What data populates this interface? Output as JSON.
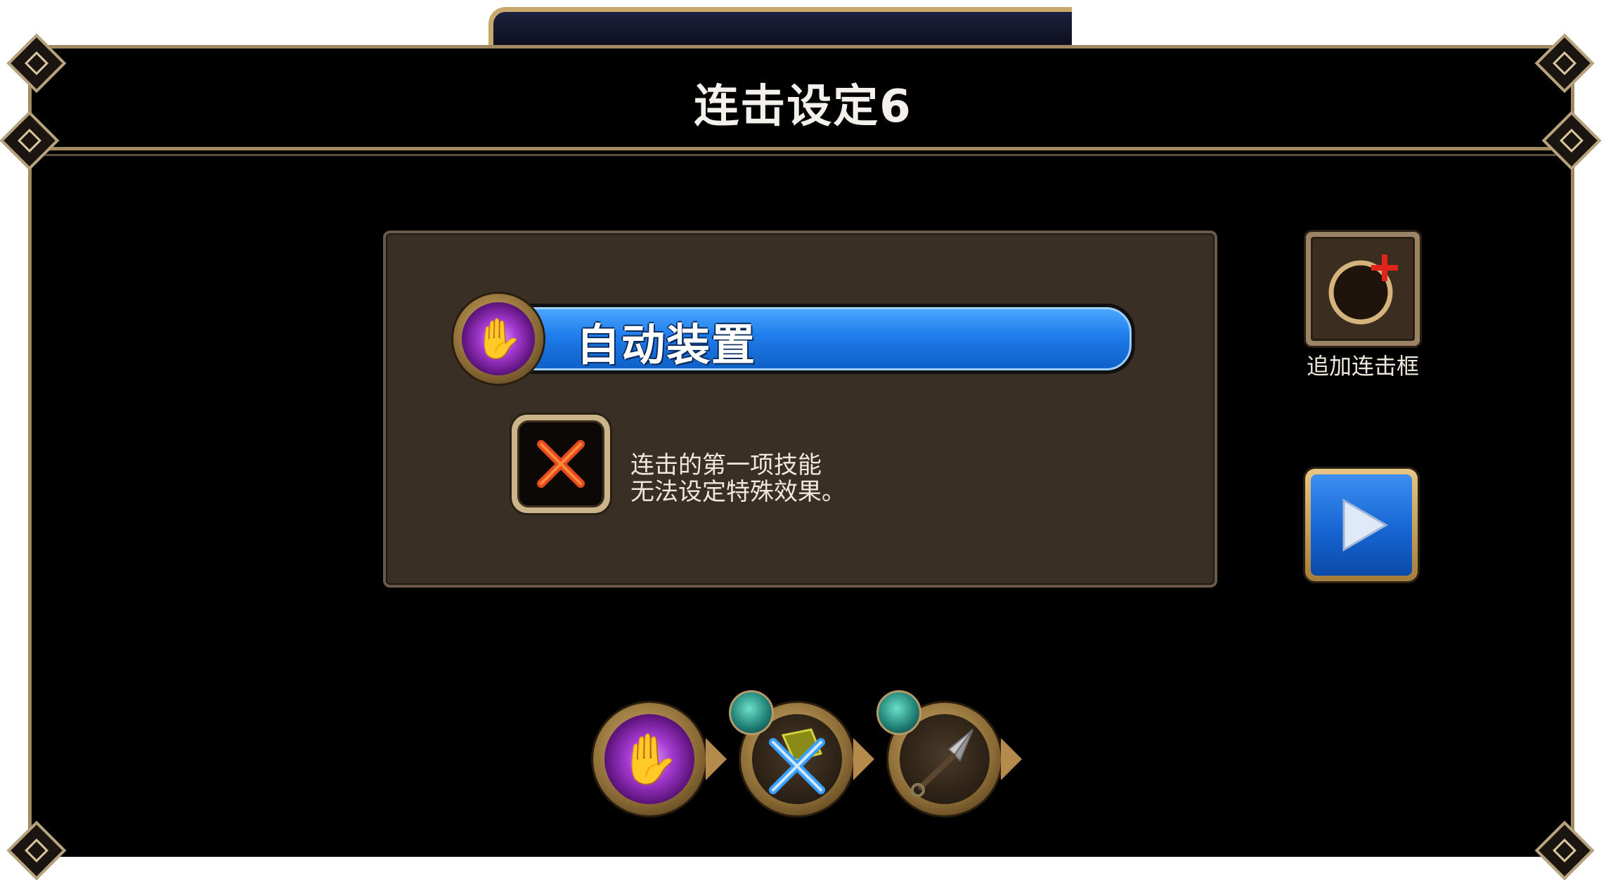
{
  "dialog": {
    "title": "连击设定6"
  },
  "auto_equip": {
    "label": "自动装置",
    "icon": "purple-hand-skill-icon"
  },
  "special_effect": {
    "icon": "red-x-icon",
    "note_line1": "连击的第一项技能",
    "note_line2": "无法设定特殊效果。"
  },
  "add_combo": {
    "label": "追加连击框",
    "icon": "add-ring-icon"
  },
  "next": {
    "icon": "play-arrow-icon"
  },
  "skill_slots": [
    {
      "icon": "purple-hand-skill-icon",
      "locked": false
    },
    {
      "icon": "crossed-swords-skill-icon",
      "locked": true
    },
    {
      "icon": "kunai-skill-icon",
      "locked": true
    }
  ],
  "colors": {
    "panel": "#3a2f25",
    "frame_border": "#a48a63",
    "bar_blue": "#1e7dec",
    "x_red": "#e54a1e"
  }
}
